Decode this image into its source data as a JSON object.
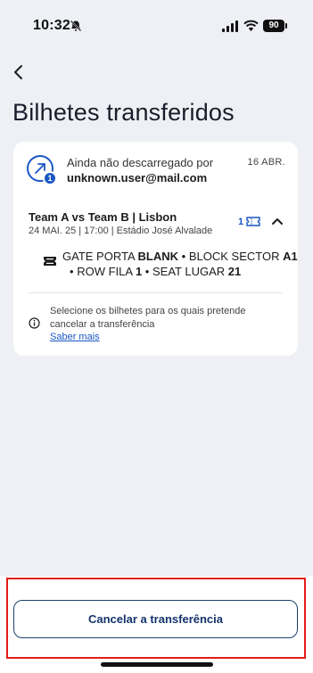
{
  "status_bar": {
    "time": "10:32",
    "battery": "90",
    "icons": [
      "bell-slash-icon",
      "signal-icon",
      "wifi-icon",
      "battery-icon"
    ]
  },
  "nav": {
    "back_icon": "chevron-left-icon"
  },
  "page": {
    "title": "Bilhetes transferidos"
  },
  "transfer": {
    "status": "Ainda não descarregado por",
    "recipient": "unknown.user@mail.com",
    "date": "16 ABR.",
    "badge_count": "1",
    "icon": "arrow-up-right-icon"
  },
  "event": {
    "title": "Team A vs Team B | Lisbon",
    "subtitle": "24 MAI. 25 | 17:00 | Estádio José Alvalade",
    "ticket_count": "1",
    "ticket_icon": "ticket-icon",
    "toggle_icon": "chevron-up-icon"
  },
  "seat": {
    "gate_label": "GATE PORTA",
    "gate_value": "BLANK",
    "block_label": "BLOCK SECTOR",
    "block_value": "A1",
    "row_label": "ROW FILA",
    "row_value": "1",
    "seat_label": "SEAT LUGAR",
    "seat_value": "21",
    "separator": "•",
    "icon": "seat-icon"
  },
  "info": {
    "text": "Selecione os bilhetes para os quais pretende cancelar a transferência",
    "link": "Saber mais",
    "icon": "info-icon"
  },
  "footer": {
    "cancel_label": "Cancelar a transferência"
  },
  "colors": {
    "accent": "#1a56c4",
    "button_text": "#14336b",
    "highlight": "#e31b1b",
    "background": "#eef0f5"
  }
}
